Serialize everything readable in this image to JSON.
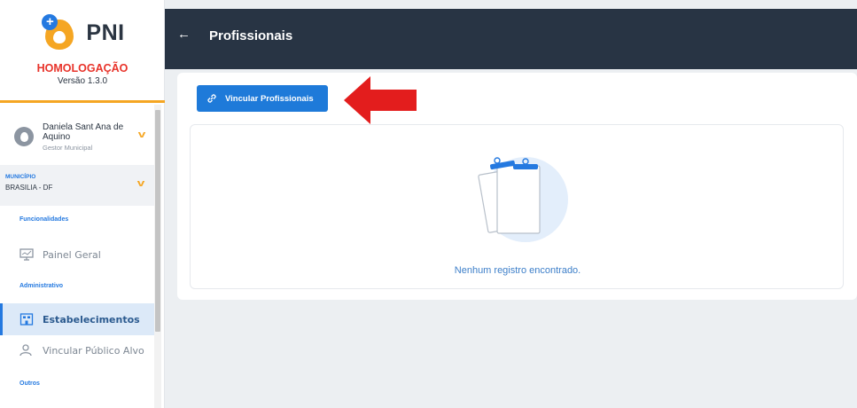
{
  "app": {
    "logo_text": "PNI",
    "environment": "HOMOLOGAÇÃO",
    "version": "Versão 1.3.0"
  },
  "user": {
    "name": "Daniela Sant Ana de Aquino",
    "role": "Gestor Municipal"
  },
  "municipio": {
    "label": "MUNICÍPIO",
    "value": "BRASILIA - DF"
  },
  "sidebar": {
    "sections": [
      {
        "title": "Funcionalidades",
        "items": [
          {
            "label": "Painel Geral",
            "icon": "monitor-icon"
          }
        ]
      },
      {
        "title": "Administrativo",
        "items": [
          {
            "label": "Estabelecimentos",
            "icon": "building-icon",
            "active": true
          },
          {
            "label": "Vincular Público Alvo",
            "icon": "user-link-icon"
          }
        ]
      },
      {
        "title": "Outros",
        "items": []
      }
    ]
  },
  "header": {
    "title": "Profissionais",
    "back_icon": "arrow-left-icon"
  },
  "toolbar": {
    "link_button_label": "Vincular Profissionais",
    "link_icon": "link-icon"
  },
  "empty_state": {
    "message": "Nenhum registro encontrado.",
    "icon": "clipboard-icon"
  },
  "colors": {
    "primary": "#1e7ad9",
    "topbar": "#283444",
    "accent_orange": "#f5a623",
    "env_red": "#e8332a",
    "arrow_red": "#e31d1d"
  }
}
